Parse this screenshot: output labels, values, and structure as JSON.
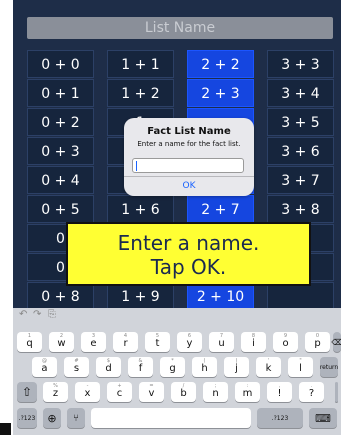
{
  "list_name_placeholder": "List Name",
  "facts": [
    [
      "0 + 0",
      "1 + 1",
      "2 + 2",
      "3 + 3"
    ],
    [
      "0 + 1",
      "1 + 2",
      "2 + 3",
      "3 + 4"
    ],
    [
      "0 + 2",
      "1",
      "",
      "3 + 5"
    ],
    [
      "0 + 3",
      "1",
      "",
      "3 + 6"
    ],
    [
      "0 + 4",
      "1",
      "",
      "3 + 7"
    ],
    [
      "0 + 5",
      "1 + 6",
      "2 + 7",
      "3 + 8"
    ],
    [
      "0",
      "",
      "",
      ""
    ],
    [
      "0",
      "",
      "",
      ""
    ],
    [
      "0 + 8",
      "1 + 9",
      "2 + 10",
      ""
    ]
  ],
  "selected_column": 2,
  "dialog": {
    "title": "Fact List Name",
    "message": "Enter a name for the fact list.",
    "input_value": "",
    "ok_label": "OK"
  },
  "callout": {
    "line1": "Enter a name.",
    "line2": "Tap OK."
  },
  "keyboard": {
    "toolbar": [
      "undo-icon",
      "redo-icon",
      "paste-icon"
    ],
    "row1": [
      {
        "main": "q",
        "sub": "1"
      },
      {
        "main": "w",
        "sub": "2"
      },
      {
        "main": "e",
        "sub": "3"
      },
      {
        "main": "r",
        "sub": "4"
      },
      {
        "main": "t",
        "sub": "5"
      },
      {
        "main": "y",
        "sub": "6"
      },
      {
        "main": "u",
        "sub": "7"
      },
      {
        "main": "i",
        "sub": "8"
      },
      {
        "main": "o",
        "sub": "9"
      },
      {
        "main": "p",
        "sub": "0"
      }
    ],
    "row2": [
      {
        "main": "a",
        "sub": "@"
      },
      {
        "main": "s",
        "sub": "#"
      },
      {
        "main": "d",
        "sub": "$"
      },
      {
        "main": "f",
        "sub": "&"
      },
      {
        "main": "g",
        "sub": "*"
      },
      {
        "main": "h",
        "sub": "("
      },
      {
        "main": "j",
        "sub": ")"
      },
      {
        "main": "k",
        "sub": "'"
      },
      {
        "main": "l",
        "sub": "\""
      }
    ],
    "row3": [
      {
        "main": "z",
        "sub": "%"
      },
      {
        "main": "x",
        "sub": "-"
      },
      {
        "main": "c",
        "sub": "+"
      },
      {
        "main": "v",
        "sub": "="
      },
      {
        "main": "b",
        "sub": "/"
      },
      {
        "main": "n",
        "sub": ";"
      },
      {
        "main": "m",
        "sub": ":"
      },
      {
        "main": "!",
        "sub": ","
      },
      {
        "main": "?",
        "sub": "."
      }
    ],
    "return_label": "return",
    "num_label": ".?123",
    "num_label_right": ".?123"
  },
  "colors": {
    "background": "#1e2d48",
    "selected": "#1546e0",
    "callout": "#ffff33",
    "link": "#1a63ff"
  }
}
